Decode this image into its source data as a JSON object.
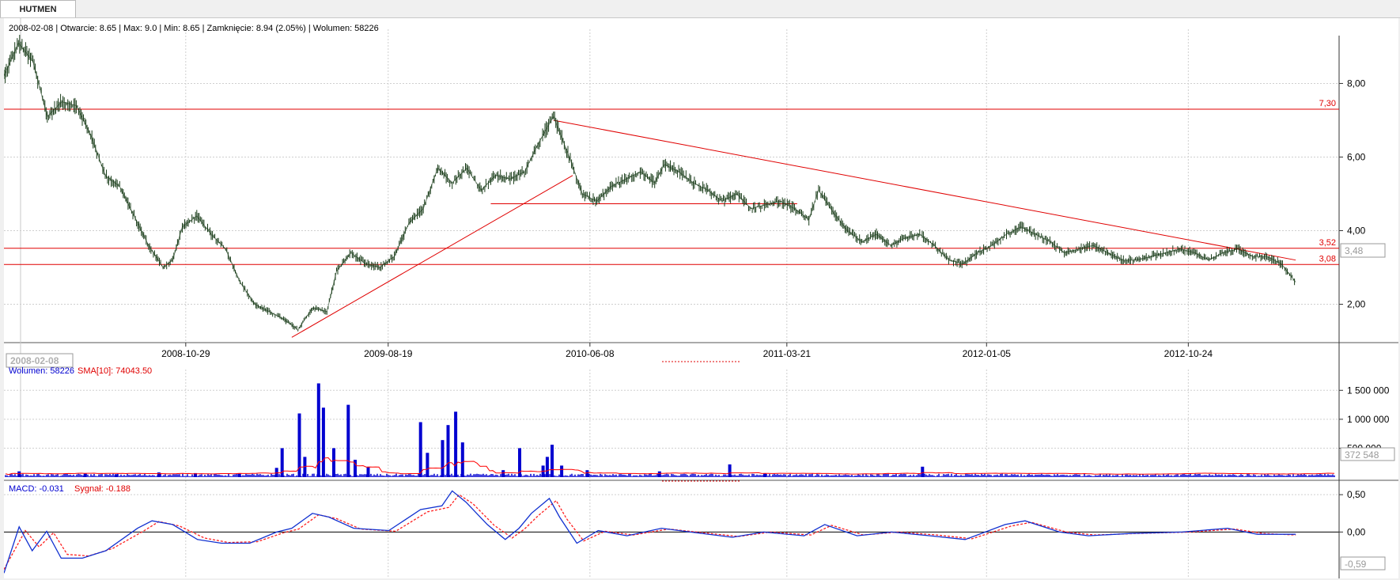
{
  "tab": {
    "label": "HUTMEN"
  },
  "price_panel": {
    "info": "2008-02-08 | Otwarcie: 8.65 | Max: 9.0 | Min: 8.65 | Zamknięcie: 8.94 (2.05%)  | Wolumen: 58226",
    "date_box": "2008-02-08",
    "current_value_box": "3,48"
  },
  "volume_panel": {
    "legend_volume": "Wolumen: 58226",
    "legend_sma": "SMA[10]: 74043.50",
    "current_value_box": "372 548"
  },
  "macd_panel": {
    "legend_macd": "MACD: -0.031",
    "legend_signal": "Sygnał: -0.188",
    "current_value_box": "-0,59"
  },
  "colors": {
    "price_line": "#1a3d1a",
    "drawing_red": "#e00000",
    "volume_blue": "#0000d0",
    "sma_red": "#ff0000",
    "macd_blue": "#1030d0",
    "signal_red": "#ff2020",
    "grid": "#cfcfcf"
  },
  "chart_data": [
    {
      "type": "line",
      "name": "price",
      "x_ticks": [
        "2008-10-29",
        "2009-08-19",
        "2010-06-08",
        "2011-03-21",
        "2012-01-05",
        "2012-10-24"
      ],
      "y_ticks": [
        "8,00",
        "6,00",
        "4,00",
        "2,00"
      ],
      "ylim": [
        1.0,
        9.3
      ],
      "x_range": [
        "2008-02-08",
        "2013-05-31"
      ],
      "series": [
        {
          "points": [
            [
              "2008-02-08",
              8.2
            ],
            [
              "2008-02-29",
              9.1
            ],
            [
              "2008-03-21",
              8.6
            ],
            [
              "2008-04-11",
              7.1
            ],
            [
              "2008-05-02",
              7.5
            ],
            [
              "2008-05-23",
              7.4
            ],
            [
              "2008-06-13",
              6.6
            ],
            [
              "2008-07-04",
              5.5
            ],
            [
              "2008-07-25",
              5.2
            ],
            [
              "2008-08-15",
              4.4
            ],
            [
              "2008-09-05",
              3.6
            ],
            [
              "2008-09-26",
              3.0
            ],
            [
              "2008-10-10",
              3.2
            ],
            [
              "2008-10-24",
              4.1
            ],
            [
              "2008-11-14",
              4.4
            ],
            [
              "2008-12-05",
              3.9
            ],
            [
              "2008-12-26",
              3.5
            ],
            [
              "2009-01-16",
              2.6
            ],
            [
              "2009-02-06",
              2.0
            ],
            [
              "2009-02-27",
              1.8
            ],
            [
              "2009-03-20",
              1.6
            ],
            [
              "2009-04-10",
              1.3
            ],
            [
              "2009-05-01",
              1.9
            ],
            [
              "2009-05-22",
              1.8
            ],
            [
              "2009-06-05",
              2.9
            ],
            [
              "2009-06-26",
              3.4
            ],
            [
              "2009-07-17",
              3.1
            ],
            [
              "2009-08-07",
              3.0
            ],
            [
              "2009-08-28",
              3.3
            ],
            [
              "2009-09-18",
              4.2
            ],
            [
              "2009-10-09",
              4.6
            ],
            [
              "2009-10-30",
              5.7
            ],
            [
              "2009-11-20",
              5.3
            ],
            [
              "2009-12-11",
              5.7
            ],
            [
              "2010-01-01",
              5.1
            ],
            [
              "2010-01-22",
              5.5
            ],
            [
              "2010-02-12",
              5.4
            ],
            [
              "2010-03-05",
              5.6
            ],
            [
              "2010-03-26",
              6.4
            ],
            [
              "2010-04-16",
              7.1
            ],
            [
              "2010-05-07",
              6.1
            ],
            [
              "2010-05-28",
              5.0
            ],
            [
              "2010-06-18",
              4.8
            ],
            [
              "2010-07-09",
              5.2
            ],
            [
              "2010-07-30",
              5.4
            ],
            [
              "2010-08-20",
              5.6
            ],
            [
              "2010-09-10",
              5.3
            ],
            [
              "2010-09-24",
              5.8
            ],
            [
              "2010-10-15",
              5.6
            ],
            [
              "2010-11-05",
              5.3
            ],
            [
              "2010-11-26",
              5.1
            ],
            [
              "2010-12-17",
              4.8
            ],
            [
              "2011-01-07",
              5.0
            ],
            [
              "2011-01-28",
              4.6
            ],
            [
              "2011-02-18",
              4.7
            ],
            [
              "2011-03-11",
              4.8
            ],
            [
              "2011-04-01",
              4.6
            ],
            [
              "2011-04-22",
              4.3
            ],
            [
              "2011-05-06",
              5.1
            ],
            [
              "2011-05-27",
              4.5
            ],
            [
              "2011-06-17",
              4.0
            ],
            [
              "2011-07-08",
              3.7
            ],
            [
              "2011-07-29",
              3.9
            ],
            [
              "2011-08-19",
              3.6
            ],
            [
              "2011-09-09",
              3.8
            ],
            [
              "2011-09-30",
              3.9
            ],
            [
              "2011-10-21",
              3.6
            ],
            [
              "2011-11-11",
              3.2
            ],
            [
              "2011-12-02",
              3.1
            ],
            [
              "2011-12-23",
              3.4
            ],
            [
              "2012-01-13",
              3.6
            ],
            [
              "2012-02-03",
              3.9
            ],
            [
              "2012-02-24",
              4.1
            ],
            [
              "2012-03-16",
              3.9
            ],
            [
              "2012-04-06",
              3.7
            ],
            [
              "2012-04-27",
              3.4
            ],
            [
              "2012-05-18",
              3.5
            ],
            [
              "2012-06-08",
              3.6
            ],
            [
              "2012-06-29",
              3.4
            ],
            [
              "2012-07-20",
              3.2
            ],
            [
              "2012-08-10",
              3.2
            ],
            [
              "2012-08-31",
              3.3
            ],
            [
              "2012-09-21",
              3.4
            ],
            [
              "2012-10-12",
              3.5
            ],
            [
              "2012-11-02",
              3.4
            ],
            [
              "2012-11-23",
              3.2
            ],
            [
              "2012-12-14",
              3.4
            ],
            [
              "2013-01-04",
              3.5
            ],
            [
              "2013-01-25",
              3.3
            ],
            [
              "2013-02-15",
              3.3
            ],
            [
              "2013-03-08",
              3.1
            ],
            [
              "2013-03-29",
              2.6
            ]
          ]
        }
      ],
      "drawings": {
        "horizontal_lines": [
          {
            "y": 7.3,
            "label": "7,30"
          },
          {
            "y": 3.52,
            "label": "3,52"
          },
          {
            "y": 3.08,
            "label": "3,08"
          },
          {
            "y": 4.73,
            "from": "2010-01-15",
            "to": "2011-04-05",
            "label": ""
          }
        ],
        "trend_lines": [
          {
            "from": [
              "2009-04-01",
              1.1
            ],
            "to": [
              "2010-05-14",
              5.5
            ]
          },
          {
            "from": [
              "2010-04-16",
              7.0
            ],
            "to": [
              "2013-03-29",
              3.2
            ]
          }
        ]
      }
    },
    {
      "type": "bar",
      "name": "volume",
      "y_ticks": [
        "1 500 000",
        "1 000 000",
        "500 000"
      ],
      "ylim": [
        0,
        1750000
      ],
      "spikes": [
        [
          "2008-03-01",
          100000
        ],
        [
          "2008-06-05",
          60000
        ],
        [
          "2008-07-20",
          50000
        ],
        [
          "2008-09-20",
          80000
        ],
        [
          "2008-11-12",
          70000
        ],
        [
          "2009-01-15",
          60000
        ],
        [
          "2009-03-10",
          160000
        ],
        [
          "2009-03-18",
          500000
        ],
        [
          "2009-04-12",
          1100000
        ],
        [
          "2009-04-20",
          350000
        ],
        [
          "2009-05-10",
          1620000
        ],
        [
          "2009-05-17",
          1200000
        ],
        [
          "2009-06-01",
          500000
        ],
        [
          "2009-06-22",
          1250000
        ],
        [
          "2009-07-02",
          300000
        ],
        [
          "2009-07-21",
          170000
        ],
        [
          "2009-10-05",
          950000
        ],
        [
          "2009-10-15",
          420000
        ],
        [
          "2009-11-06",
          640000
        ],
        [
          "2009-11-14",
          900000
        ],
        [
          "2009-11-25",
          1130000
        ],
        [
          "2009-12-05",
          600000
        ],
        [
          "2010-02-02",
          120000
        ],
        [
          "2010-02-26",
          500000
        ],
        [
          "2010-04-01",
          200000
        ],
        [
          "2010-04-07",
          350000
        ],
        [
          "2010-04-14",
          560000
        ],
        [
          "2010-04-28",
          200000
        ],
        [
          "2010-06-04",
          120000
        ],
        [
          "2010-09-17",
          100000
        ],
        [
          "2010-12-28",
          220000
        ],
        [
          "2011-02-17",
          60000
        ],
        [
          "2011-10-04",
          180000
        ]
      ],
      "sma_period": 10
    },
    {
      "type": "line",
      "name": "macd",
      "y_ticks": [
        "0,50",
        "0,00"
      ],
      "ylim": [
        -0.6,
        0.65
      ],
      "series": [
        {
          "name": "MACD",
          "points": [
            [
              "2008-02-08",
              -0.55
            ],
            [
              "2008-03-01",
              0.07
            ],
            [
              "2008-03-20",
              -0.25
            ],
            [
              "2008-04-10",
              0.01
            ],
            [
              "2008-05-01",
              -0.35
            ],
            [
              "2008-06-01",
              -0.35
            ],
            [
              "2008-07-05",
              -0.25
            ],
            [
              "2008-08-20",
              0.05
            ],
            [
              "2008-09-10",
              0.15
            ],
            [
              "2008-10-10",
              0.1
            ],
            [
              "2008-11-15",
              -0.1
            ],
            [
              "2008-12-20",
              -0.15
            ],
            [
              "2009-01-30",
              -0.15
            ],
            [
              "2009-03-10",
              0.0
            ],
            [
              "2009-04-01",
              0.05
            ],
            [
              "2009-05-01",
              0.25
            ],
            [
              "2009-05-25",
              0.2
            ],
            [
              "2009-06-30",
              0.05
            ],
            [
              "2009-08-20",
              0.02
            ],
            [
              "2009-10-05",
              0.3
            ],
            [
              "2009-11-05",
              0.35
            ],
            [
              "2009-11-20",
              0.55
            ],
            [
              "2009-12-10",
              0.4
            ],
            [
              "2010-01-10",
              0.1
            ],
            [
              "2010-02-05",
              -0.1
            ],
            [
              "2010-02-25",
              0.05
            ],
            [
              "2010-03-15",
              0.25
            ],
            [
              "2010-04-10",
              0.45
            ],
            [
              "2010-04-25",
              0.2
            ],
            [
              "2010-05-20",
              -0.15
            ],
            [
              "2010-06-20",
              0.02
            ],
            [
              "2010-08-01",
              -0.05
            ],
            [
              "2010-09-20",
              0.05
            ],
            [
              "2010-11-01",
              0.0
            ],
            [
              "2011-01-01",
              -0.07
            ],
            [
              "2011-02-15",
              0.0
            ],
            [
              "2011-04-15",
              -0.05
            ],
            [
              "2011-05-15",
              0.1
            ],
            [
              "2011-07-01",
              -0.05
            ],
            [
              "2011-08-20",
              0.0
            ],
            [
              "2011-10-15",
              -0.05
            ],
            [
              "2011-12-05",
              -0.1
            ],
            [
              "2012-02-01",
              0.1
            ],
            [
              "2012-03-01",
              0.15
            ],
            [
              "2012-04-20",
              0.0
            ],
            [
              "2012-06-01",
              -0.05
            ],
            [
              "2012-08-01",
              -0.02
            ],
            [
              "2012-10-15",
              0.0
            ],
            [
              "2012-12-20",
              0.05
            ],
            [
              "2013-02-01",
              -0.03
            ],
            [
              "2013-03-29",
              -0.03
            ]
          ]
        },
        {
          "name": "Sygnał",
          "points": [
            [
              "2008-02-08",
              -0.5
            ],
            [
              "2008-03-10",
              0.02
            ],
            [
              "2008-03-30",
              -0.2
            ],
            [
              "2008-04-20",
              -0.01
            ],
            [
              "2008-05-10",
              -0.3
            ],
            [
              "2008-06-10",
              -0.32
            ],
            [
              "2008-07-15",
              -0.22
            ],
            [
              "2008-08-30",
              0.02
            ],
            [
              "2008-09-20",
              0.14
            ],
            [
              "2008-10-20",
              0.08
            ],
            [
              "2008-11-25",
              -0.08
            ],
            [
              "2008-12-30",
              -0.14
            ],
            [
              "2009-02-10",
              -0.13
            ],
            [
              "2009-03-20",
              -0.01
            ],
            [
              "2009-04-11",
              0.04
            ],
            [
              "2009-05-10",
              0.23
            ],
            [
              "2009-06-05",
              0.18
            ],
            [
              "2009-07-10",
              0.04
            ],
            [
              "2009-08-30",
              0.01
            ],
            [
              "2009-10-15",
              0.27
            ],
            [
              "2009-11-15",
              0.33
            ],
            [
              "2009-11-30",
              0.5
            ],
            [
              "2009-12-20",
              0.38
            ],
            [
              "2010-01-20",
              0.09
            ],
            [
              "2010-02-15",
              -0.08
            ],
            [
              "2010-03-05",
              0.04
            ],
            [
              "2010-03-25",
              0.22
            ],
            [
              "2010-04-20",
              0.42
            ],
            [
              "2010-05-05",
              0.18
            ],
            [
              "2010-05-30",
              -0.12
            ],
            [
              "2010-06-30",
              0.01
            ],
            [
              "2010-08-10",
              -0.04
            ],
            [
              "2010-09-30",
              0.04
            ],
            [
              "2010-11-10",
              0.0
            ],
            [
              "2011-01-10",
              -0.06
            ],
            [
              "2011-02-25",
              0.0
            ],
            [
              "2011-04-25",
              -0.04
            ],
            [
              "2011-05-25",
              0.09
            ],
            [
              "2011-07-10",
              -0.04
            ],
            [
              "2011-08-30",
              0.0
            ],
            [
              "2011-10-25",
              -0.04
            ],
            [
              "2011-12-15",
              -0.09
            ],
            [
              "2012-02-10",
              0.08
            ],
            [
              "2012-03-10",
              0.13
            ],
            [
              "2012-04-30",
              0.0
            ],
            [
              "2012-06-10",
              -0.04
            ],
            [
              "2012-08-10",
              -0.02
            ],
            [
              "2012-10-25",
              0.0
            ],
            [
              "2012-12-30",
              0.04
            ],
            [
              "2013-02-10",
              -0.02
            ],
            [
              "2013-03-29",
              -0.04
            ]
          ]
        }
      ]
    }
  ]
}
